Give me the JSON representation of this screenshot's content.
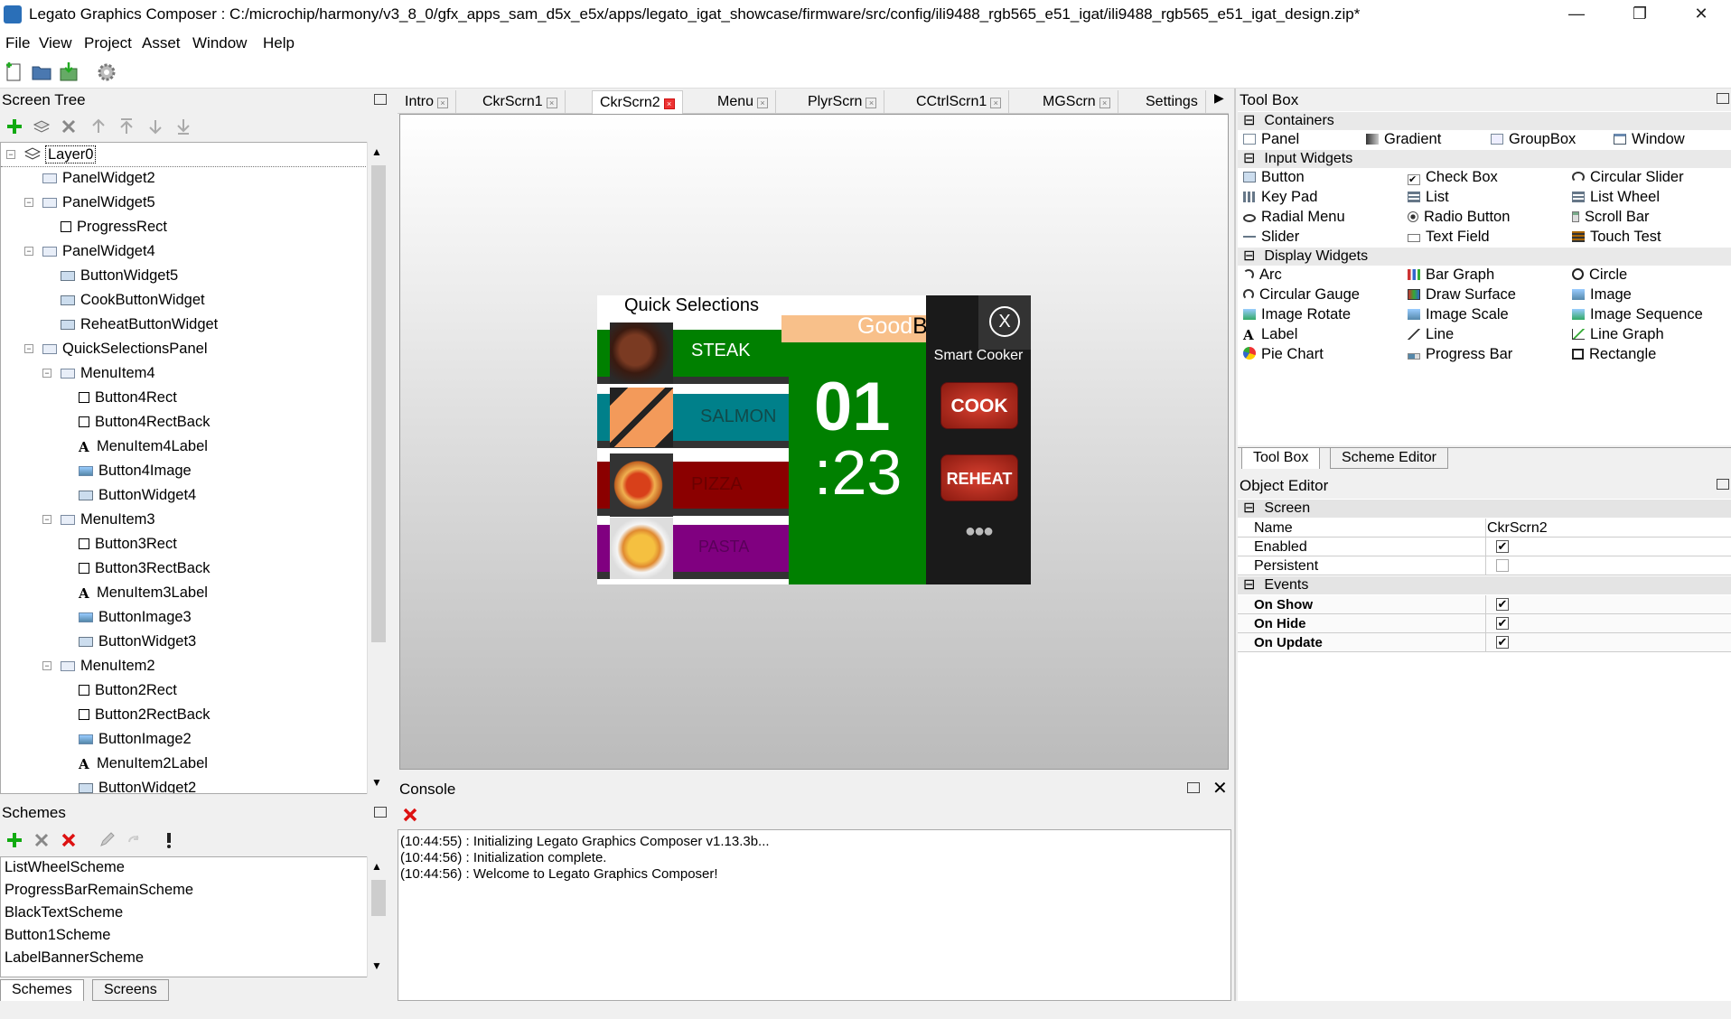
{
  "window": {
    "title": "Legato Graphics Composer : C:/microchip/harmony/v3_8_0/gfx_apps_sam_d5x_e5x/apps/legato_igat_showcase/firmware/src/config/ili9488_rgb565_e51_igat/ili9488_rgb565_e51_igat_design.zip*",
    "minimize": "—",
    "restore": "❐",
    "close": "✕"
  },
  "menu": [
    "File",
    "View",
    "Project",
    "Asset",
    "Window",
    "Help"
  ],
  "screen_tree": {
    "title": "Screen Tree",
    "nodes": [
      {
        "label": "Layer0",
        "icon": "layer-icon"
      },
      {
        "label": "PanelWidget2",
        "icon": "panel-icon"
      },
      {
        "label": "PanelWidget5",
        "icon": "panel-icon"
      },
      {
        "label": "ProgressRect",
        "icon": "rectangle-icon"
      },
      {
        "label": "PanelWidget4",
        "icon": "panel-icon"
      },
      {
        "label": "ButtonWidget5",
        "icon": "button-icon"
      },
      {
        "label": "CookButtonWidget",
        "icon": "button-icon"
      },
      {
        "label": "ReheatButtonWidget",
        "icon": "button-icon"
      },
      {
        "label": "QuickSelectionsPanel",
        "icon": "panel-icon"
      },
      {
        "label": "MenuItem4",
        "icon": "panel-icon"
      },
      {
        "label": "Button4Rect",
        "icon": "rectangle-icon"
      },
      {
        "label": "Button4RectBack",
        "icon": "rectangle-icon"
      },
      {
        "label": "MenuItem4Label",
        "icon": "label-icon"
      },
      {
        "label": "Button4Image",
        "icon": "image-icon"
      },
      {
        "label": "ButtonWidget4",
        "icon": "button-icon"
      },
      {
        "label": "MenuItem3",
        "icon": "panel-icon"
      },
      {
        "label": "Button3Rect",
        "icon": "rectangle-icon"
      },
      {
        "label": "Button3RectBack",
        "icon": "rectangle-icon"
      },
      {
        "label": "MenuItem3Label",
        "icon": "label-icon"
      },
      {
        "label": "ButtonImage3",
        "icon": "image-icon"
      },
      {
        "label": "ButtonWidget3",
        "icon": "button-icon"
      },
      {
        "label": "MenuItem2",
        "icon": "panel-icon"
      },
      {
        "label": "Button2Rect",
        "icon": "rectangle-icon"
      },
      {
        "label": "Button2RectBack",
        "icon": "rectangle-icon"
      },
      {
        "label": "ButtonImage2",
        "icon": "image-icon"
      },
      {
        "label": "MenuItem2Label",
        "icon": "label-icon"
      },
      {
        "label": "ButtonWidget2",
        "icon": "button-icon"
      }
    ]
  },
  "schemes": {
    "title": "Schemes",
    "items": [
      "ListWheelScheme",
      "ProgressBarRemainScheme",
      "BlackTextScheme",
      "Button1Scheme",
      "LabelBannerScheme"
    ],
    "tabs": [
      "Schemes",
      "Screens"
    ]
  },
  "tabs": [
    "Intro",
    "CkrScrn1",
    "CkrScrn2",
    "Menu",
    "PlyrScrn",
    "CCtrlScrn1",
    "MGScrn",
    "Settings"
  ],
  "active_tab": "CkrScrn2",
  "device": {
    "panel_title": "Quick Selections",
    "items": [
      {
        "label": "STEAK",
        "color": "#008000"
      },
      {
        "label": "SALMON",
        "color": "#00808a"
      },
      {
        "label": "PIZZA",
        "color": "#8b0000"
      },
      {
        "label": "PASTA",
        "color": "#800080"
      }
    ],
    "brand_good": "Good",
    "brand_bytes": "Bytes",
    "close_label": "X",
    "subtitle": "Smart Cooker",
    "timer_min": "01",
    "timer_sec": ":23",
    "cook_label": "COOK",
    "reheat_label": "REHEAT",
    "more_label": "●●●"
  },
  "console": {
    "title": "Console",
    "lines": [
      "(10:44:55) : Initializing Legato Graphics Composer v1.13.3b...",
      "(10:44:56) : Initialization complete.",
      "(10:44:56) : Welcome to Legato Graphics Composer!"
    ]
  },
  "toolbox": {
    "title": "Tool Box",
    "sections": [
      {
        "name": "Containers",
        "items": [
          {
            "label": "Panel",
            "icon": "panel-icon"
          },
          {
            "label": "Gradient",
            "icon": "gradient-icon"
          },
          {
            "label": "GroupBox",
            "icon": "groupbox-icon"
          },
          {
            "label": "Window",
            "icon": "window-icon"
          }
        ]
      },
      {
        "name": "Input Widgets",
        "items": [
          {
            "label": "Button",
            "icon": "button-icon"
          },
          {
            "label": "Check Box",
            "icon": "checkbox-icon"
          },
          {
            "label": "Circular Slider",
            "icon": "circular-slider-icon"
          },
          {
            "label": "Key Pad",
            "icon": "keypad-icon"
          },
          {
            "label": "List",
            "icon": "list-icon"
          },
          {
            "label": "List Wheel",
            "icon": "list-wheel-icon"
          },
          {
            "label": "Radial Menu",
            "icon": "radial-menu-icon"
          },
          {
            "label": "Radio Button",
            "icon": "radio-button-icon"
          },
          {
            "label": "Scroll Bar",
            "icon": "scroll-bar-icon"
          },
          {
            "label": "Slider",
            "icon": "slider-icon"
          },
          {
            "label": "Text Field",
            "icon": "text-field-icon"
          },
          {
            "label": "Touch Test",
            "icon": "touch-test-icon"
          }
        ]
      },
      {
        "name": "Display Widgets",
        "items": [
          {
            "label": "Arc",
            "icon": "arc-icon"
          },
          {
            "label": "Bar Graph",
            "icon": "bar-graph-icon"
          },
          {
            "label": "Circle",
            "icon": "circle-icon"
          },
          {
            "label": "Circular Gauge",
            "icon": "circular-gauge-icon"
          },
          {
            "label": "Draw Surface",
            "icon": "draw-surface-icon"
          },
          {
            "label": "Image",
            "icon": "image-icon"
          },
          {
            "label": "Image Rotate",
            "icon": "image-rotate-icon"
          },
          {
            "label": "Image Scale",
            "icon": "image-scale-icon"
          },
          {
            "label": "Image Sequence",
            "icon": "image-sequence-icon"
          },
          {
            "label": "Label",
            "icon": "label-icon"
          },
          {
            "label": "Line",
            "icon": "line-icon"
          },
          {
            "label": "Line Graph",
            "icon": "line-graph-icon"
          },
          {
            "label": "Pie Chart",
            "icon": "pie-chart-icon"
          },
          {
            "label": "Progress Bar",
            "icon": "progress-bar-icon"
          },
          {
            "label": "Rectangle",
            "icon": "rectangle-icon"
          }
        ]
      }
    ],
    "bottom_tabs": [
      "Tool Box",
      "Scheme Editor"
    ]
  },
  "object_editor": {
    "title": "Object Editor",
    "sections": [
      {
        "name": "Screen",
        "rows": [
          {
            "key": "Name",
            "value": "CkrScrn2",
            "type": "text"
          },
          {
            "key": "Enabled",
            "checked": true,
            "type": "check"
          },
          {
            "key": "Persistent",
            "checked": false,
            "type": "check"
          }
        ]
      },
      {
        "name": "Events",
        "rows": [
          {
            "key": "On Show",
            "checked": true,
            "type": "check"
          },
          {
            "key": "On Hide",
            "checked": true,
            "type": "check"
          },
          {
            "key": "On Update",
            "checked": true,
            "type": "check"
          }
        ]
      }
    ]
  }
}
